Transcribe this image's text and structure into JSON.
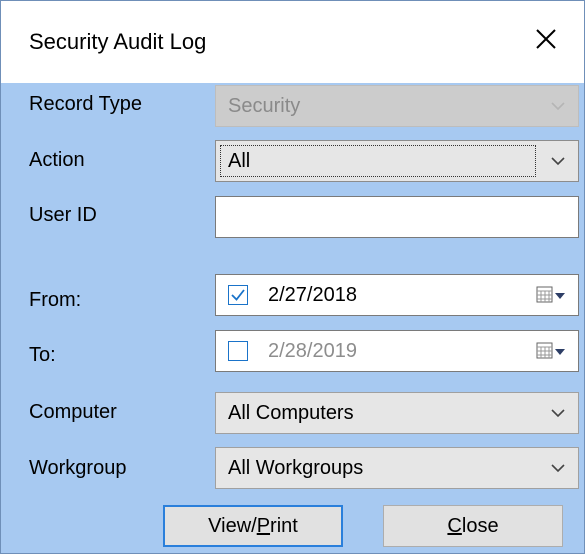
{
  "window": {
    "title": "Security Audit Log"
  },
  "form": {
    "record_type": {
      "label": "Record Type",
      "value": "Security"
    },
    "action": {
      "label": "Action",
      "value": "All"
    },
    "user_id": {
      "label": "User ID",
      "value": ""
    },
    "from": {
      "label": "From:",
      "checked": true,
      "value": "2/27/2018"
    },
    "to": {
      "label": "To:",
      "checked": false,
      "value": "2/28/2019"
    },
    "computer": {
      "label": "Computer",
      "value": "All Computers"
    },
    "workgroup": {
      "label": "Workgroup",
      "value": "All Workgroups"
    }
  },
  "buttons": {
    "view_print": {
      "pre": "View/",
      "mnemonic": "P",
      "post": "rint"
    },
    "close": {
      "pre": "",
      "mnemonic": "C",
      "post": "lose"
    }
  }
}
